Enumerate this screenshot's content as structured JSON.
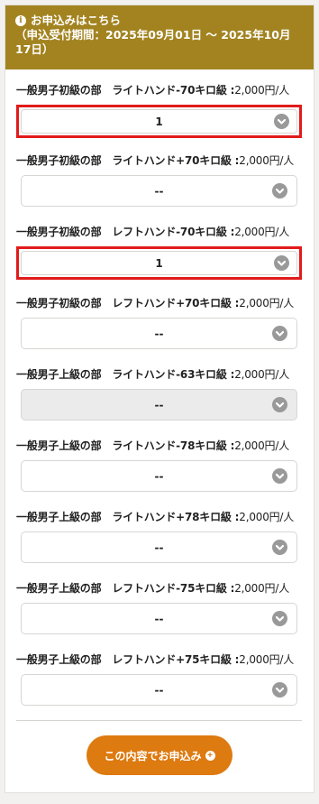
{
  "header": {
    "title": "お申込みはこちら",
    "period": "（申込受付期間：2025年09月01日 〜 2025年10月17日）",
    "icon": "info-icon",
    "color": "#a28320"
  },
  "items": [
    {
      "division": "一般男子初級の部",
      "category": "ライトハンド-70キロ級",
      "sep": " :",
      "price": "2,000円/人",
      "value": "1",
      "state": "selected"
    },
    {
      "division": "一般男子初級の部",
      "category": "ライトハンド+70キロ級",
      "sep": " :",
      "price": "2,000円/人",
      "value": "--",
      "state": "normal"
    },
    {
      "division": "一般男子初級の部",
      "category": "レフトハンド-70キロ級",
      "sep": " :",
      "price": "2,000円/人",
      "value": "1",
      "state": "selected"
    },
    {
      "division": "一般男子初級の部",
      "category": "レフトハンド+70キロ級",
      "sep": " :",
      "price": "2,000円/人",
      "value": "--",
      "state": "normal"
    },
    {
      "division": "一般男子上級の部",
      "category": "ライトハンド-63キロ級",
      "sep": " :",
      "price": "2,000円/人",
      "value": "--",
      "state": "disabled"
    },
    {
      "division": "一般男子上級の部",
      "category": "ライトハンド-78キロ級",
      "sep": " :",
      "price": "2,000円/人",
      "value": "--",
      "state": "normal"
    },
    {
      "division": "一般男子上級の部",
      "category": "ライトハンド+78キロ級",
      "sep": " :",
      "price": "2,000円/人",
      "value": "--",
      "state": "normal"
    },
    {
      "division": "一般男子上級の部",
      "category": "レフトハンド-75キロ級",
      "sep": " :",
      "price": "2,000円/人",
      "value": "--",
      "state": "normal"
    },
    {
      "division": "一般男子上級の部",
      "category": "レフトハンド+75キロ級",
      "sep": " :",
      "price": "2,000円/人",
      "value": "--",
      "state": "normal"
    }
  ],
  "submit": {
    "label": "この内容でお申込み",
    "icon": "plus-circle-icon",
    "color": "#dd7a10"
  },
  "colors": {
    "highlight": "#e11b1b",
    "chevron": "#999999"
  }
}
